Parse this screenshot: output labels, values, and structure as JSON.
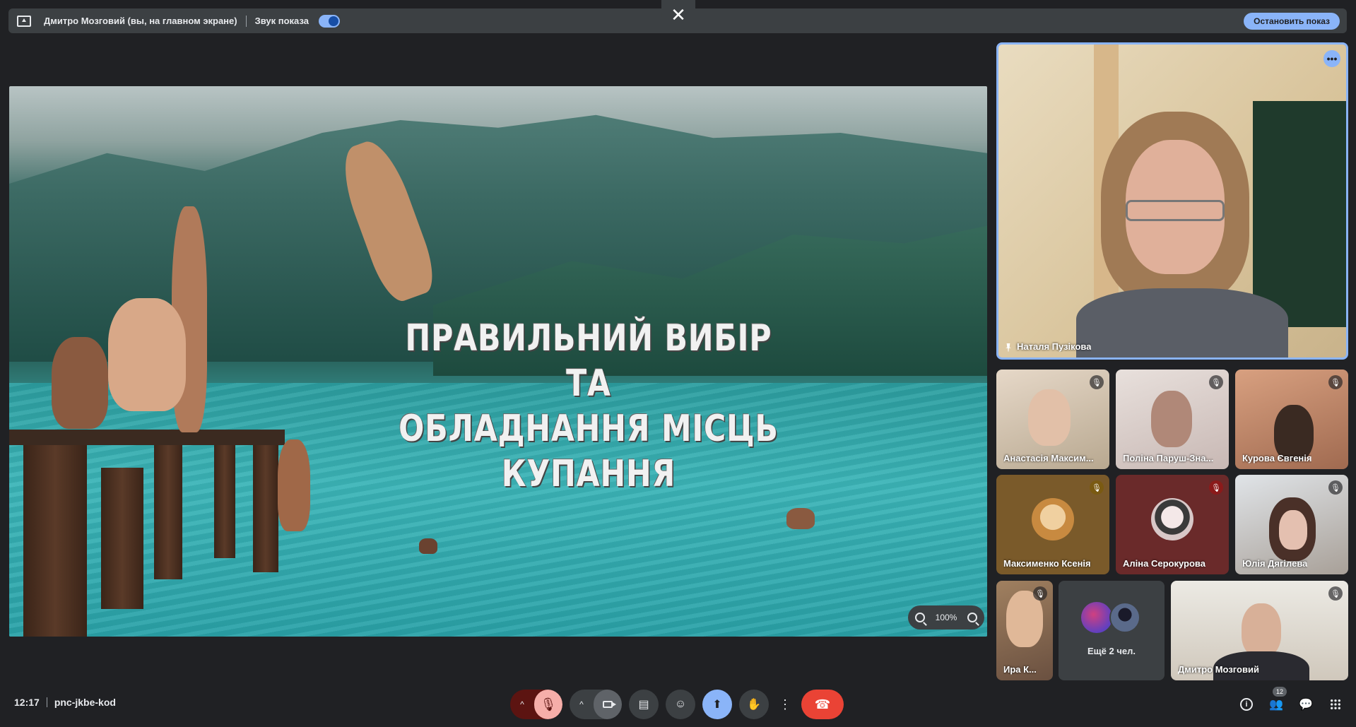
{
  "presenting_bar": {
    "presenter_text": "Дмитро Мозговий (вы, на главном экране)",
    "sound_label": "Звук показа",
    "sound_on": true,
    "stop_label": "Остановить показ",
    "close_glyph": "✕"
  },
  "slide": {
    "title_line1": "ПРАВИЛЬНИЙ ВИБІР ТА",
    "title_line2": "ОБЛАДНАННЯ МІСЦЬ КУПАННЯ",
    "zoom_value": "100%"
  },
  "main_participant": {
    "name": "Наталя Пузікова",
    "more_glyph": "•••"
  },
  "participants": [
    {
      "name": "Анастасія Максим...",
      "muted": true,
      "tile_color": "#c9b9a8"
    },
    {
      "name": "Поліна Паруш-Зна...",
      "muted": true,
      "tile_color": "#b9a6a0"
    },
    {
      "name": "Курова Євгенія",
      "muted": true,
      "tile_color": "#b07c60"
    },
    {
      "name": "Максименко Ксенія",
      "muted": true,
      "tile_color": "#7a5a2a"
    },
    {
      "name": "Аліна Серокурова",
      "muted": true,
      "tile_color": "#6a2a2a"
    },
    {
      "name": "Юлія Дягілева",
      "muted": true,
      "tile_color": "#7a6a5a"
    },
    {
      "name": "Ира К...",
      "muted": true,
      "tile_color": "#8a6a50"
    },
    {
      "name": "Дмитро Мозговий",
      "muted": true,
      "tile_color": "#d8d2c8"
    }
  ],
  "more_people_label": "Ещё 2 чел.",
  "bottom_bar": {
    "time": "12:17",
    "meeting_code": "pnc-jkbe-kod",
    "participants_count": "12"
  },
  "colors": {
    "accent": "#8ab4f8",
    "hangup": "#ea4335",
    "background": "#202124"
  }
}
